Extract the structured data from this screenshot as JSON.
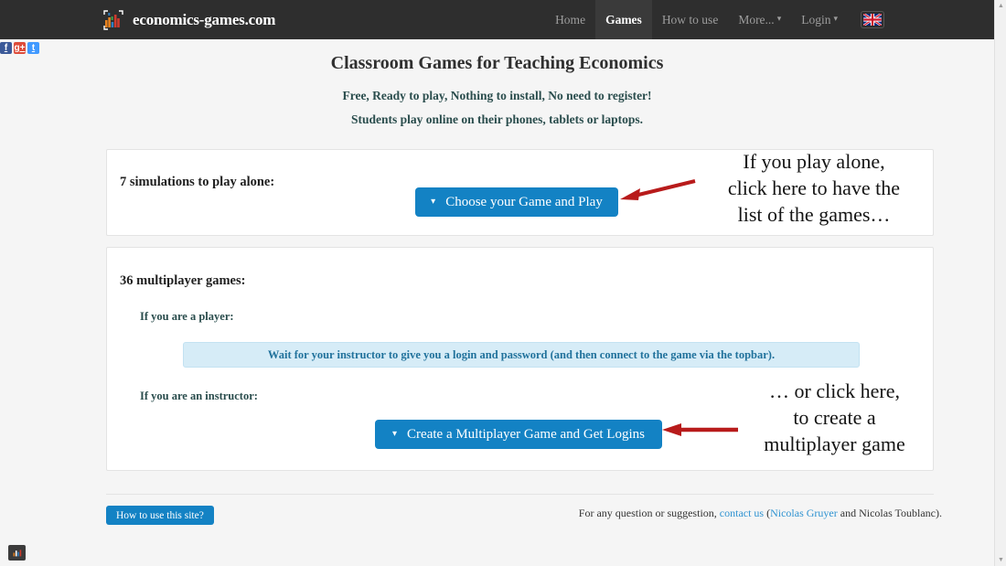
{
  "header": {
    "brand_name": "economics-games.com",
    "logo_icon": "bar-chart-logo-icon",
    "nav": [
      {
        "label": "Home",
        "active": false,
        "caret": false
      },
      {
        "label": "Games",
        "active": true,
        "caret": false
      },
      {
        "label": "How to use",
        "active": false,
        "caret": false
      },
      {
        "label": "More...",
        "active": false,
        "caret": true
      },
      {
        "label": "Login",
        "active": false,
        "caret": true
      }
    ],
    "language_flag": "uk-flag-icon",
    "caret_glyph": "▾"
  },
  "social": [
    {
      "name": "facebook-icon",
      "glyph": "f",
      "color": "#3b5998"
    },
    {
      "name": "google-plus-icon",
      "glyph": "g+",
      "color": "#dd4b39"
    },
    {
      "name": "twitter-icon",
      "glyph": "t",
      "color": "#4099ff"
    }
  ],
  "hero": {
    "title": "Classroom Games for Teaching Economics",
    "subtitle_1": "Free, Ready to play, Nothing to install, No need to register!",
    "subtitle_2": "Students play online on their phones, tablets or laptops."
  },
  "panel_solo": {
    "heading": "7 simulations to play alone:",
    "button_label": "Choose your Game and Play",
    "button_caret": "▾"
  },
  "panel_multi": {
    "heading": "36 multiplayer games:",
    "player_label": "If you are a player:",
    "info_text": "Wait for your instructor to give you a login and password (and then connect to the game via the topbar).",
    "instructor_label": "If you are an instructor:",
    "button_label": "Create a Multiplayer Game and Get Logins",
    "button_caret": "▾"
  },
  "annotations": [
    {
      "name": "annotation-play-alone",
      "text": "If you play alone,\nclick here to have the\nlist of the games…",
      "arrow": "red-arrow-left-icon"
    },
    {
      "name": "annotation-create-game",
      "text": "… or click here,\nto create a\nmultiplayer game",
      "arrow": "red-arrow-left-icon"
    }
  ],
  "footer": {
    "howto_button": "How to use this site?",
    "text_before": "For any question or suggestion, ",
    "contact_link": "contact us",
    "text_middle": " (",
    "author_link": "Nicolas Gruyer",
    "text_after": " and Nicolas Toublanc)."
  },
  "corner_widget": {
    "name": "site-logo-badge-icon"
  },
  "scrollbar": {
    "up_glyph": "▲",
    "down_glyph": "▼"
  },
  "colors": {
    "topbar": "#2e2e2e",
    "accent_blue": "#1382c4",
    "info_bg": "#d6ecf7",
    "info_text": "#21729c",
    "annotation_red": "#b81b1b",
    "teal_text": "#2a4d4d"
  }
}
